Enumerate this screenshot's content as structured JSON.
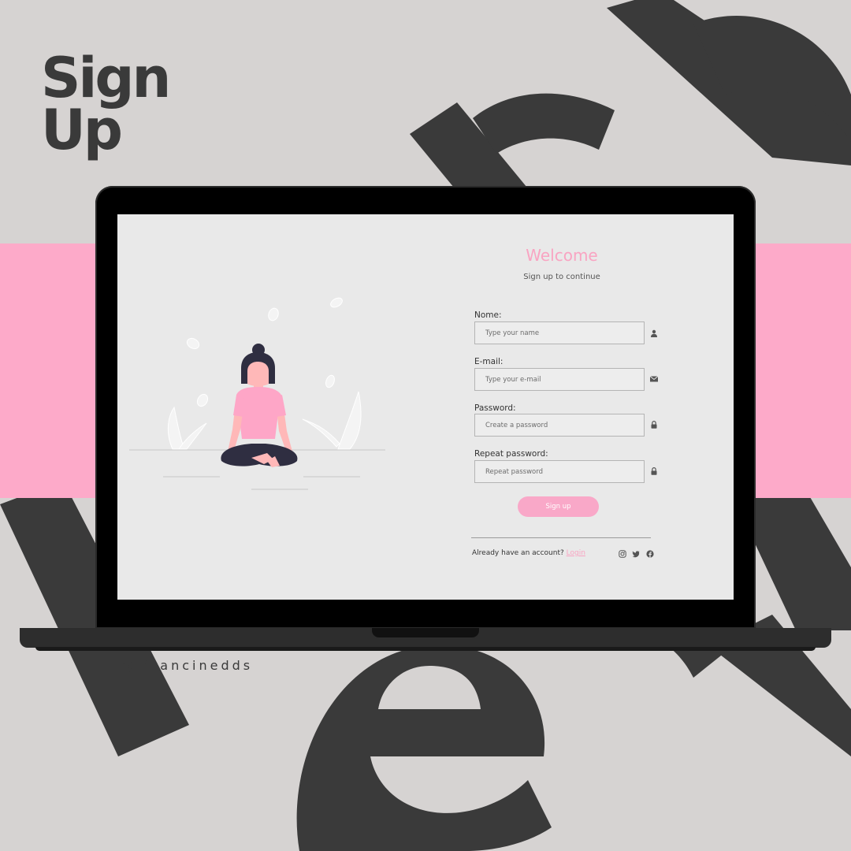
{
  "poster": {
    "title_line1": "Sign",
    "title_line2": "Up",
    "credit": "@ francinedds"
  },
  "colors": {
    "background": "#d6d3d2",
    "accent_pink": "#fdaac9",
    "dark_text": "#3a3a3a",
    "screen_bg": "#e9e9e9"
  },
  "screen": {
    "welcome": "Welcome",
    "subtitle": "Sign up to continue",
    "fields": [
      {
        "label": "Nome:",
        "placeholder": "Type your name",
        "icon": "user-icon"
      },
      {
        "label": "E-mail:",
        "placeholder": "Type your e-mail",
        "icon": "envelope-icon"
      },
      {
        "label": "Password:",
        "placeholder": "Create a password",
        "icon": "lock-icon"
      },
      {
        "label": "Repeat password:",
        "placeholder": "Repeat password",
        "icon": "lock-icon"
      }
    ],
    "signup_button": "Sign up",
    "footer": {
      "prompt": "Already have an account?",
      "login_link": "Login",
      "social_icons": [
        "instagram-icon",
        "twitter-icon",
        "facebook-icon"
      ]
    }
  }
}
